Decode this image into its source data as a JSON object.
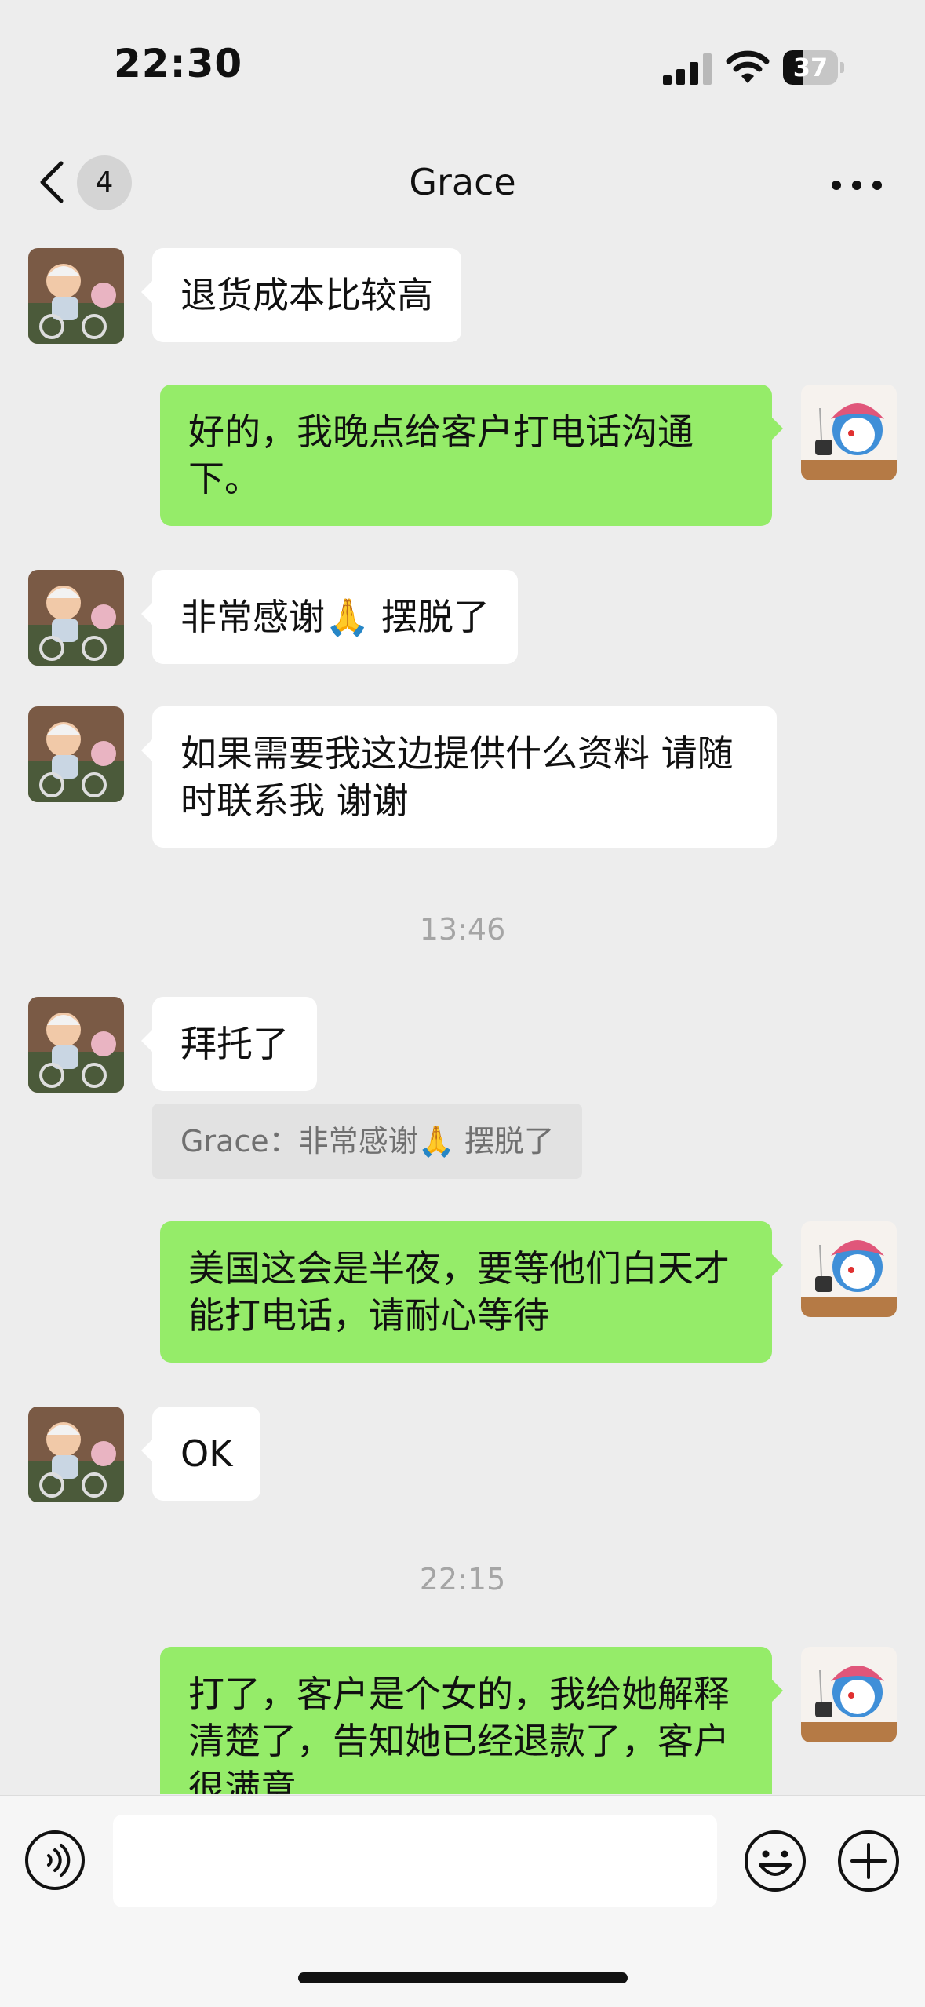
{
  "status_bar": {
    "time": "22:30",
    "battery": "37",
    "battery_level": 0.37
  },
  "nav": {
    "back_badge": "4",
    "title": "Grace",
    "icons": {
      "back": "chevron-left-icon",
      "more": "more-dots-icon"
    }
  },
  "messages": [
    {
      "dir": "in",
      "text": "退货成本比较高"
    },
    {
      "dir": "out",
      "text": "好的，我晚点给客户打电话沟通下。"
    },
    {
      "dir": "in",
      "text": "非常感谢🙏 摆脱了"
    },
    {
      "dir": "in",
      "text": "如果需要我这边提供什么资料 请随时联系我 谢谢"
    },
    {
      "timestamp": "13:46"
    },
    {
      "dir": "in",
      "text": "拜托了",
      "quote": "Grace：非常感谢🙏 摆脱了"
    },
    {
      "dir": "out",
      "text": "美国这会是半夜，要等他们白天才能打电话，请耐心等待"
    },
    {
      "dir": "in",
      "text": "OK"
    },
    {
      "timestamp": "22:15"
    },
    {
      "dir": "out",
      "text": "打了，客户是个女的，我给她解释清楚了，告知她已经退款了，客户很满意"
    }
  ],
  "input_bar": {
    "placeholder": "",
    "icons": {
      "voice": "voice-icon",
      "emoji": "emoji-icon",
      "plus": "plus-icon"
    }
  },
  "colors": {
    "background": "#ededed",
    "outgoing_bubble": "#95ec69",
    "incoming_bubble": "#ffffff"
  }
}
